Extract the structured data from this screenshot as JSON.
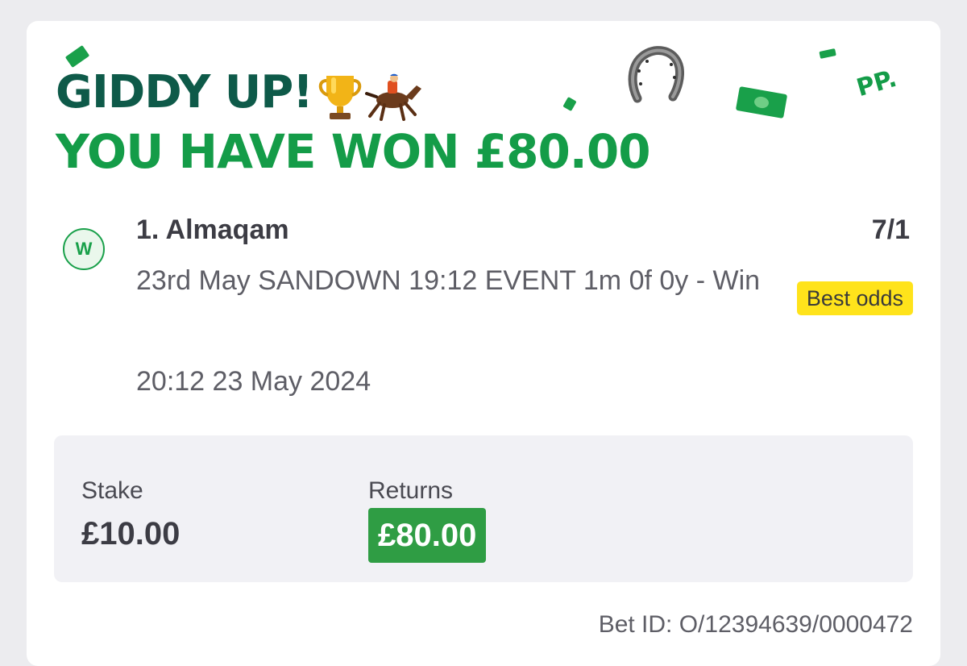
{
  "header": {
    "line1": "GIDDY UP!",
    "line2": "YOU HAVE WON £80.00",
    "logo_text": "PP."
  },
  "icons": {
    "trophy": "trophy-icon",
    "horse_racing": "horse-racing-icon",
    "horseshoe": "horseshoe-icon"
  },
  "bet": {
    "result_badge": "W",
    "selection": "1. Almaqam",
    "odds": "7/1",
    "market": "23rd May SANDOWN 19:12 EVENT 1m 0f 0y - Win",
    "best_odds_label": "Best odds",
    "placed_time": "20:12 23 May 2024"
  },
  "stake": {
    "stake_label": "Stake",
    "stake_value": "£10.00",
    "returns_label": "Returns",
    "returns_value": "£80.00"
  },
  "footer": {
    "bet_id": "Bet ID: O/12394639/0000472"
  },
  "colors": {
    "dark_green": "#0e5a49",
    "brand_green": "#149c48",
    "returns_green": "#2f9d44",
    "best_odds_yellow": "#ffe31b",
    "panel_grey": "#f1f1f5"
  }
}
